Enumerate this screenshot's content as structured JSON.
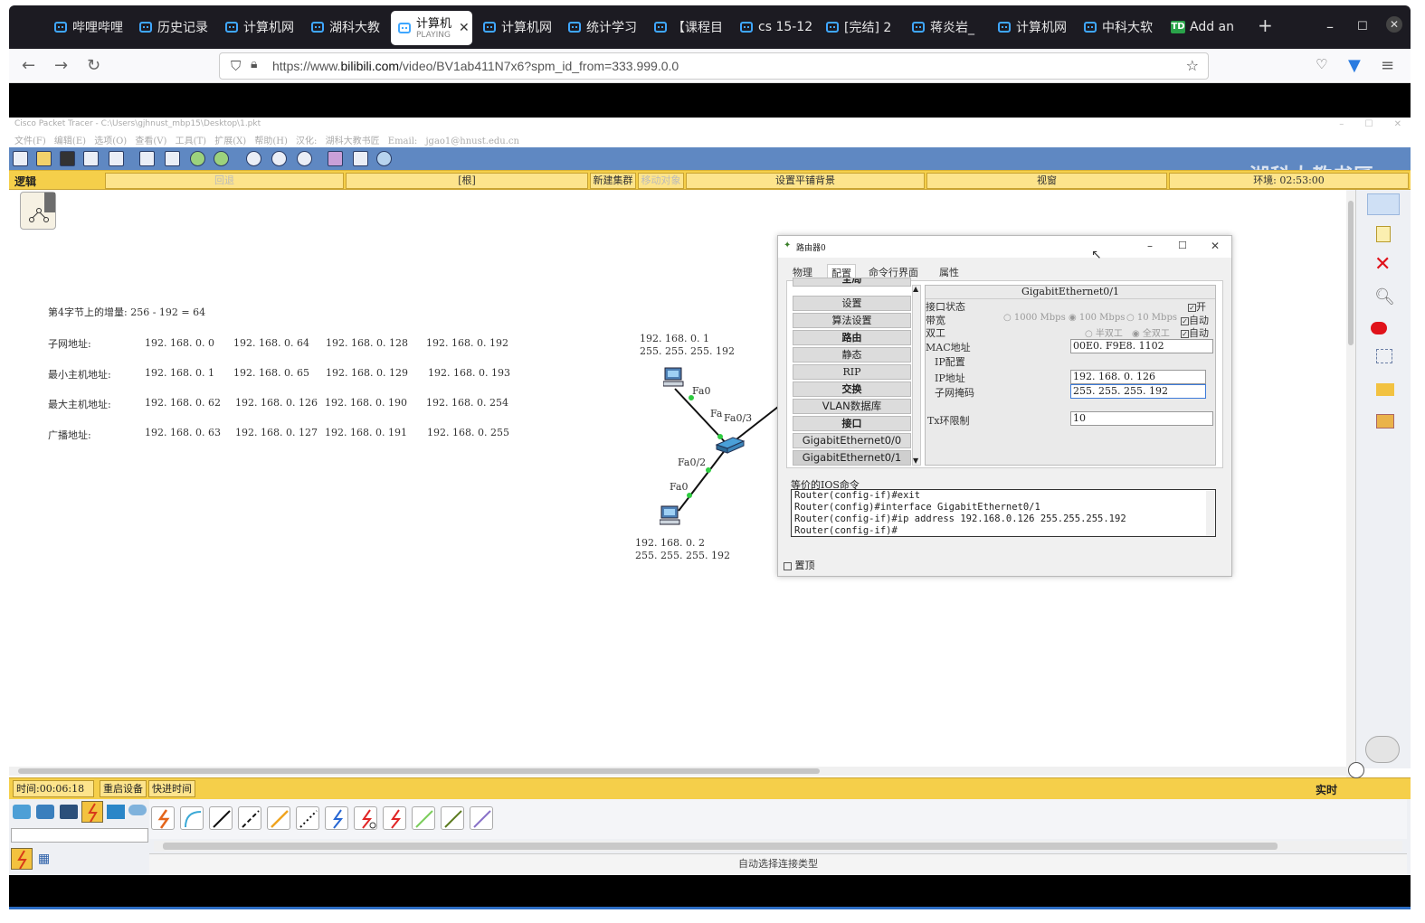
{
  "browser": {
    "tabs": [
      {
        "label": "哔哩哔哩"
      },
      {
        "label": "历史记录"
      },
      {
        "label": "计算机网"
      },
      {
        "label": "湖科大教"
      },
      {
        "label": "计算机",
        "sub": "PLAYING",
        "active": true
      },
      {
        "label": "计算机网"
      },
      {
        "label": "统计学习"
      },
      {
        "label": "【课程目"
      },
      {
        "label": "cs 15-12"
      },
      {
        "label": "[完结] 2"
      },
      {
        "label": "蒋炎岩_"
      },
      {
        "label": "计算机网"
      },
      {
        "label": "中科大软"
      },
      {
        "label": "Add an",
        "icon": "TD"
      }
    ],
    "url_prefix": "https://www.",
    "url_domain": "bilibili.com",
    "url_rest": "/video/BV1ab411N7x6?spm_id_from=333.999.0.0"
  },
  "pt": {
    "title": "Cisco Packet Tracer - C:\\Users\\gjhnust_mbp15\\Desktop\\1.pkt",
    "menu": "文件(F)  编辑(E)  选项(O)  查看(V)  工具(T)  扩展(X)  帮助(H)  汉化: 湖科大教书匠  Email: jgao1@hnust.edu.cn",
    "watermark": "湖科大教书匠",
    "help": "?",
    "yellowbar": {
      "logic": "逻辑",
      "back": "回退",
      "root": "[根]",
      "new_cluster": "新建集群",
      "move_obj": "移动对象",
      "bg": "设置平铺背景",
      "viewport": "视窗",
      "env": "环境: 02:53:00"
    },
    "notes": {
      "increment": "第4字节上的增量: 256  -  192  =  64",
      "rows": [
        {
          "label": "子网地址:",
          "vals": [
            "192. 168. 0. 0",
            "192. 168. 0. 64",
            "192. 168. 0. 128",
            "192. 168. 0. 192"
          ]
        },
        {
          "label": "最小主机地址:",
          "vals": [
            "192. 168. 0. 1",
            "192. 168. 0. 65",
            "192. 168. 0. 129",
            "192. 168. 0. 193"
          ]
        },
        {
          "label": "最大主机地址:",
          "vals": [
            "192. 168. 0. 62",
            "192. 168. 0. 126",
            "192. 168. 0. 190",
            "192. 168. 0. 254"
          ]
        },
        {
          "label": "广播地址:",
          "vals": [
            "192. 168. 0. 63",
            "192. 168. 0. 127",
            "192. 168. 0. 191",
            "192. 168. 0. 255"
          ]
        }
      ]
    },
    "topo": {
      "pc1_ip": "192. 168. 0. 1",
      "pc1_mask": "255. 255. 255. 192",
      "pc2_ip": "192. 168. 0. 2",
      "pc2_mask": "255. 255. 255. 192",
      "fa0_top": "Fa0",
      "fa_sw_top": "Fa",
      "fa03": "Fa0/3",
      "fa02": "Fa0/2",
      "fa0_bottom": "Fa0"
    },
    "status": {
      "time": "时间:00:06:18",
      "restart": "重启设备",
      "fastfwd": "快进时间",
      "realtime": "实时"
    },
    "auto_conn": "自动选择连接类型"
  },
  "dialog": {
    "title": "路由器0",
    "tabs": [
      "物理",
      "配置",
      "命令行界面",
      "属性"
    ],
    "selected_tab": "配置",
    "left_items": [
      {
        "label": "全局",
        "style": "bold"
      },
      {
        "label": "设置"
      },
      {
        "label": "算法设置"
      },
      {
        "label": "路由",
        "style": "bold"
      },
      {
        "label": "静态"
      },
      {
        "label": "RIP"
      },
      {
        "label": "交换",
        "style": "bold"
      },
      {
        "label": "VLAN数据库"
      },
      {
        "label": "接口",
        "style": "bold"
      },
      {
        "label": "GigabitEthernet0/0"
      },
      {
        "label": "GigabitEthernet0/1"
      }
    ],
    "iface_name": "GigabitEthernet0/1",
    "port_status_label": "接口状态",
    "port_on": "开",
    "bandwidth_label": "带宽",
    "bw_1000": "1000 Mbps",
    "bw_100": "100 Mbps",
    "bw_10": "10 Mbps",
    "auto": "自动",
    "duplex_label": "双工",
    "half": "半双工",
    "full": "全双工",
    "mac_label": "MAC地址",
    "mac": "00E0. F9E8. 1102",
    "ipcfg_label": "IP配置",
    "ip_label": "IP地址",
    "ip": "192. 168. 0. 126",
    "mask_label": "子网掩码",
    "mask": "255. 255. 255. 192",
    "tx_label": "Tx环限制",
    "tx": "10",
    "ios_label": "等价的IOS命令",
    "ios": [
      "Router(config-if)#exit",
      "Router(config)#interface GigabitEthernet0/1",
      "Router(config-if)#ip address 192.168.0.126 255.255.255.192",
      "Router(config-if)#"
    ],
    "top_label": "置顶"
  }
}
